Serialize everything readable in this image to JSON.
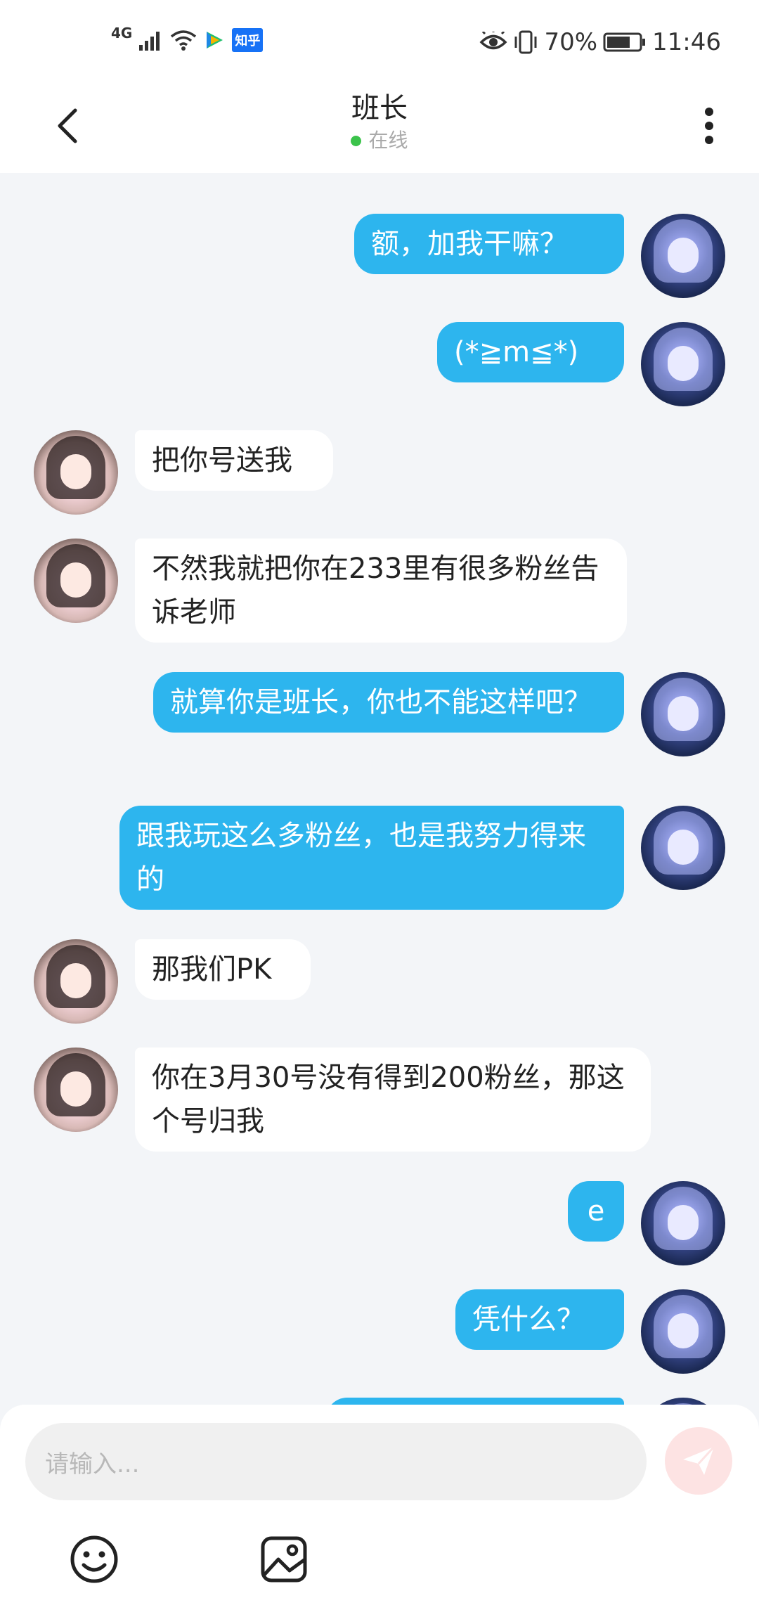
{
  "status_bar": {
    "network": "4G",
    "zhihu_label": "知乎",
    "battery": "70%",
    "time": "11:46"
  },
  "header": {
    "title": "班长",
    "status": "在线"
  },
  "messages": [
    {
      "from": "me",
      "text": "额，加我干嘛？"
    },
    {
      "from": "me",
      "text": "(*≧m≦*)"
    },
    {
      "from": "them",
      "text": "把你号送我"
    },
    {
      "from": "them",
      "text": "不然我就把你在233里有很多粉丝告诉老师"
    },
    {
      "from": "me",
      "text": "就算你是班长，你也不能这样吧？"
    },
    {
      "from": "me",
      "text": "跟我玩这么多粉丝，也是我努力得来的"
    },
    {
      "from": "them",
      "text": "那我们PK"
    },
    {
      "from": "them",
      "text": "你在3月30号没有得到200粉丝，那这个号归我"
    },
    {
      "from": "me",
      "text": "e"
    },
    {
      "from": "me",
      "text": "凭什么？"
    }
  ],
  "composer": {
    "placeholder": "请输入..."
  },
  "colors": {
    "my_bubble": "#2db5ee",
    "their_bubble": "#ffffff",
    "online_dot": "#3bc34b",
    "send_button": "#fde3e3"
  }
}
